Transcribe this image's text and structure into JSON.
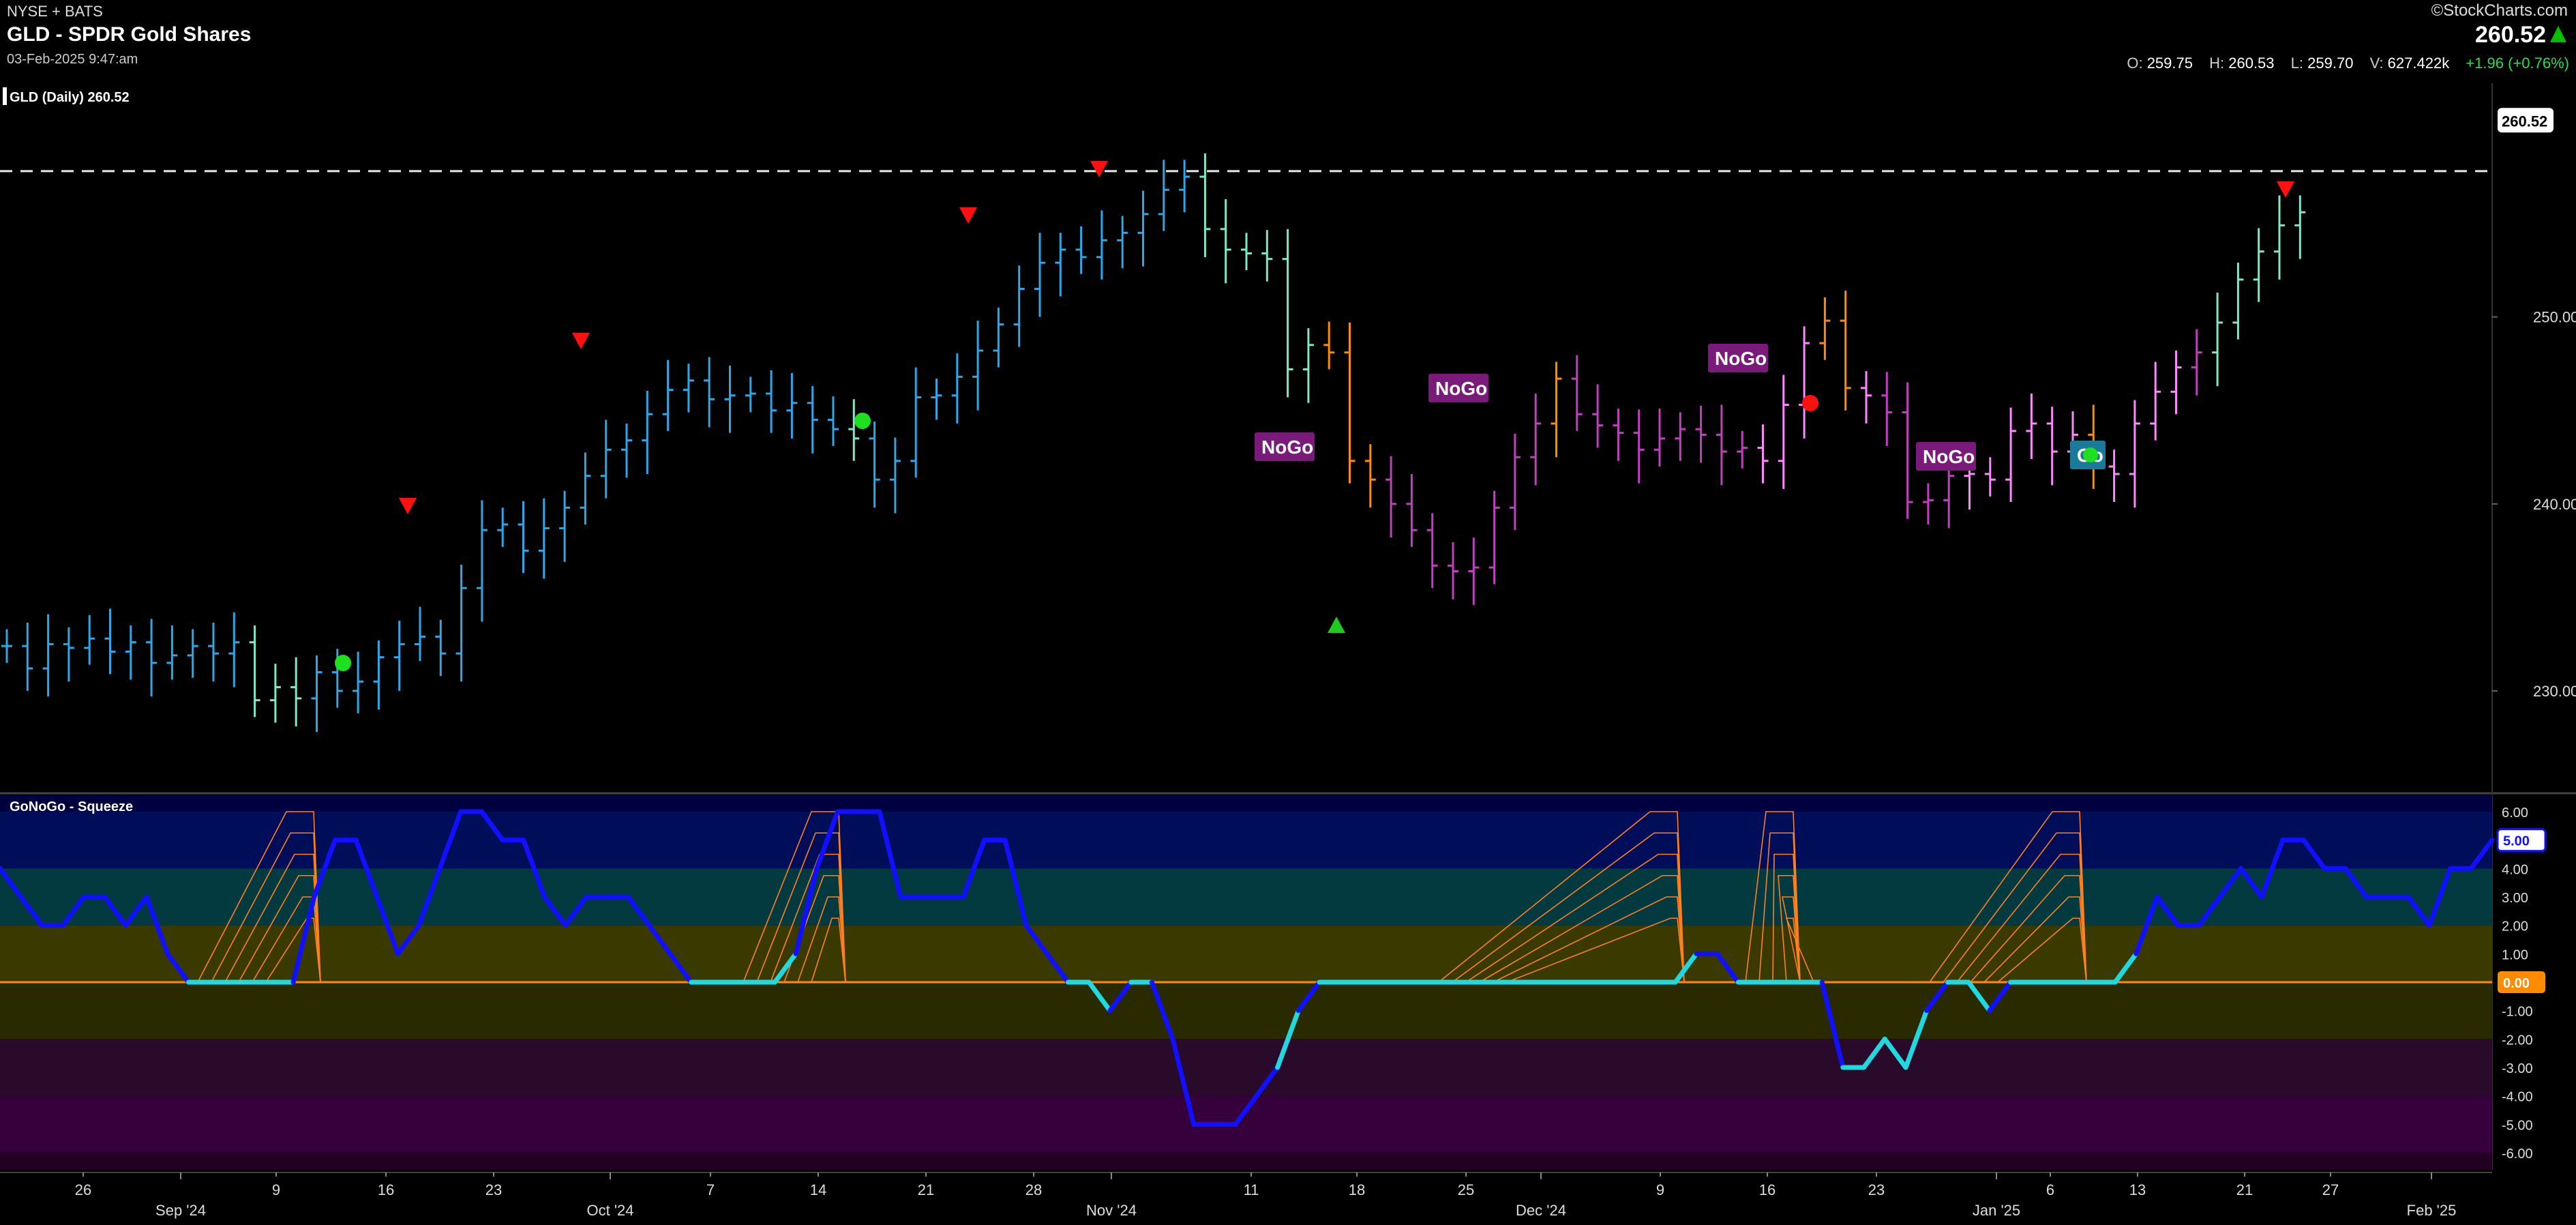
{
  "header": {
    "exchange": "NYSE + BATS",
    "title": "GLD - SPDR Gold Shares",
    "datetime": "03-Feb-2025 9:47:am",
    "brand": "©StockCharts.com",
    "last_price": "260.52",
    "ohlc": {
      "open_label": "O:",
      "open": "259.75",
      "high_label": "H:",
      "high": "260.53",
      "low_label": "L:",
      "low": "259.70",
      "volume_label": "V:",
      "volume": "627.422k",
      "change": "+1.96 (+0.76%)"
    }
  },
  "colors": {
    "strong_go": "#2aa8e8",
    "go": "#7fe8c8",
    "nogo": "#c040c0",
    "weak_nogo": "#ff88ff",
    "neither": "#ff8c00",
    "oscillator_blue": "#1010ff",
    "oscillator_aqua": "#22d8e0",
    "squeeze": "#ff8020",
    "zero_line": "#ff8c00"
  },
  "chart_data": [
    {
      "type": "ohlc",
      "panel": "price",
      "legend": "GLD (Daily) 260.52",
      "x_start": "2024-08-22",
      "x_end": "2025-02-03",
      "y_ticks": [
        "230.00",
        "240.00",
        "250.00"
      ],
      "ylim": [
        225,
        262.5
      ],
      "last_value_label": "260.52",
      "resistance_level": 257.8,
      "x_tick_labels": [
        "26",
        "Sep '24",
        "9",
        "16",
        "23",
        "Oct '24",
        "7",
        "14",
        "21",
        "28",
        "Nov '24",
        "11",
        "18",
        "25",
        "Dec '24",
        "9",
        "16",
        "23",
        "Jan '25",
        "6",
        "13",
        "21",
        "27",
        "Feb '25"
      ],
      "series": [
        {
          "color": "strong_go",
          "values": [
            232.4,
            231.2,
            232.5,
            232.3,
            232.8,
            232.1,
            232.6,
            231.5,
            231.9,
            232.4,
            232.0,
            232.6,
            231.0,
            230.0,
            230.5,
            231.8,
            232.5,
            231.8,
            232.9,
            232.0,
            232.5,
            235.5,
            238.6,
            238.9,
            237.5,
            238.7,
            239.8,
            241.5,
            242.9,
            243.4,
            244.8,
            246.1,
            246.6,
            245.6,
            245.8,
            245.9,
            245.0,
            245.4,
            244.5,
            244.0,
            243.5,
            244.7,
            245.7,
            245.8,
            246.8,
            248.2,
            249.6,
            251.5,
            252.9,
            253.6,
            254.2,
            253.8,
            253.3,
            254.1,
            254.5,
            255.5,
            256.8,
            257.5
          ]
        },
        {
          "color": "go",
          "values": [
            229.5,
            230.2,
            229.6,
            247.2,
            248.5,
            248.1,
            254.7,
            254.0,
            253.3,
            253.4,
            253.1,
            242.0,
            241.6,
            240.9,
            243.1,
            247.3,
            248.1,
            249.7,
            252.0
          ]
        },
        {
          "color": "neither",
          "values": [
            242.3,
            241.3,
            240.0,
            248.6,
            251.5,
            246.7,
            248.8,
            250.6,
            249.8
          ]
        },
        {
          "color": "nogo",
          "values": [
            236.7,
            236.4,
            236.6,
            239.8,
            242.5,
            244.3,
            244.8,
            244.2,
            243.8,
            242.9,
            243.5,
            244.0,
            242.8,
            243.0,
            242.3,
            241.7,
            242.7,
            246.2,
            245.8,
            244.9,
            240.1,
            240.2,
            241.5,
            240.7
          ]
        },
        {
          "color": "weak_nogo",
          "values": [
            245.3,
            245.0,
            244.6,
            244.5,
            243.7,
            247.6,
            240.3,
            240.7,
            241.8,
            241.6,
            241.3,
            243.9,
            244.3,
            242.8,
            243.7
          ]
        }
      ],
      "annotations": [
        "NoGo",
        "NoGo",
        "NoGo",
        "NoGo",
        "Go"
      ]
    },
    {
      "type": "line",
      "panel": "oscillator",
      "legend": "GoNoGo - Squeeze",
      "y_ticks": [
        "6.00",
        "5.00",
        "4.00",
        "3.00",
        "2.00",
        "1.00",
        "0.00",
        "-1.00",
        "-2.00",
        "-3.00",
        "-4.00",
        "-5.00",
        "-6.00"
      ],
      "ylim": [
        -6.6,
        6.6
      ],
      "current_value_label": "5.00",
      "zero_label": "0.00",
      "values": [
        4,
        3,
        2,
        2,
        3,
        3,
        2,
        3,
        1,
        0,
        0,
        0,
        0,
        0,
        0,
        3,
        5,
        5,
        3,
        1,
        2,
        4,
        6,
        6,
        5,
        5,
        3,
        2,
        3,
        3,
        3,
        2,
        1,
        0,
        0,
        0,
        0,
        0,
        1,
        4,
        6,
        6,
        6,
        3,
        3,
        3,
        3,
        5,
        5,
        2,
        1,
        0,
        0,
        -1,
        0,
        0,
        -2,
        -5,
        -5,
        -5,
        -4,
        -3,
        -1,
        0,
        0,
        0,
        0,
        0,
        0,
        0,
        0,
        0,
        0,
        0,
        0,
        0,
        0,
        0,
        0,
        0,
        0,
        1,
        1,
        0,
        0,
        0,
        0,
        0,
        -3,
        -3,
        -2,
        -3,
        -1,
        0,
        0,
        -1,
        0,
        0,
        0,
        0,
        0,
        0,
        1,
        3,
        2,
        2,
        3,
        4,
        3,
        5,
        5,
        4,
        4,
        3,
        3,
        3,
        2,
        4,
        4,
        5
      ]
    }
  ]
}
